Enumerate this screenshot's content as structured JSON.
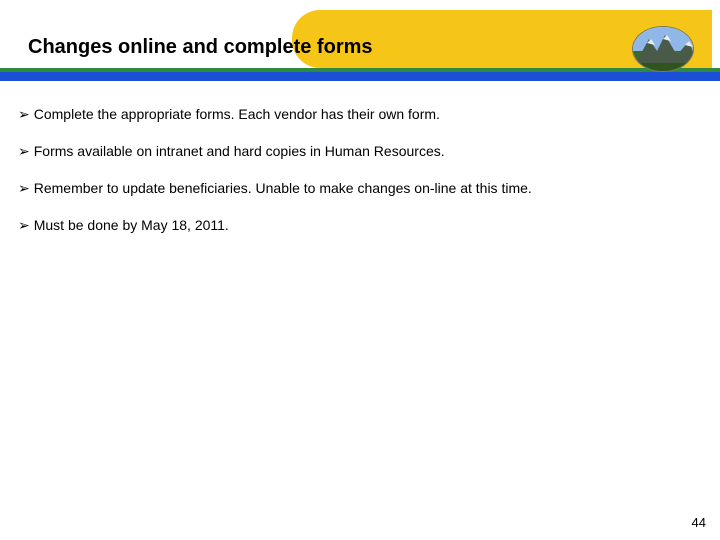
{
  "title": "Changes online and complete forms",
  "bullets": [
    "Complete the appropriate forms. Each vendor has their own form.",
    "Forms available on intranet and hard copies in Human Resources.",
    "Remember to update beneficiaries. Unable to make changes on-line  at this time.",
    "Must be done by May 18, 2011."
  ],
  "bullet_glyph": "➢",
  "page_number": "44"
}
